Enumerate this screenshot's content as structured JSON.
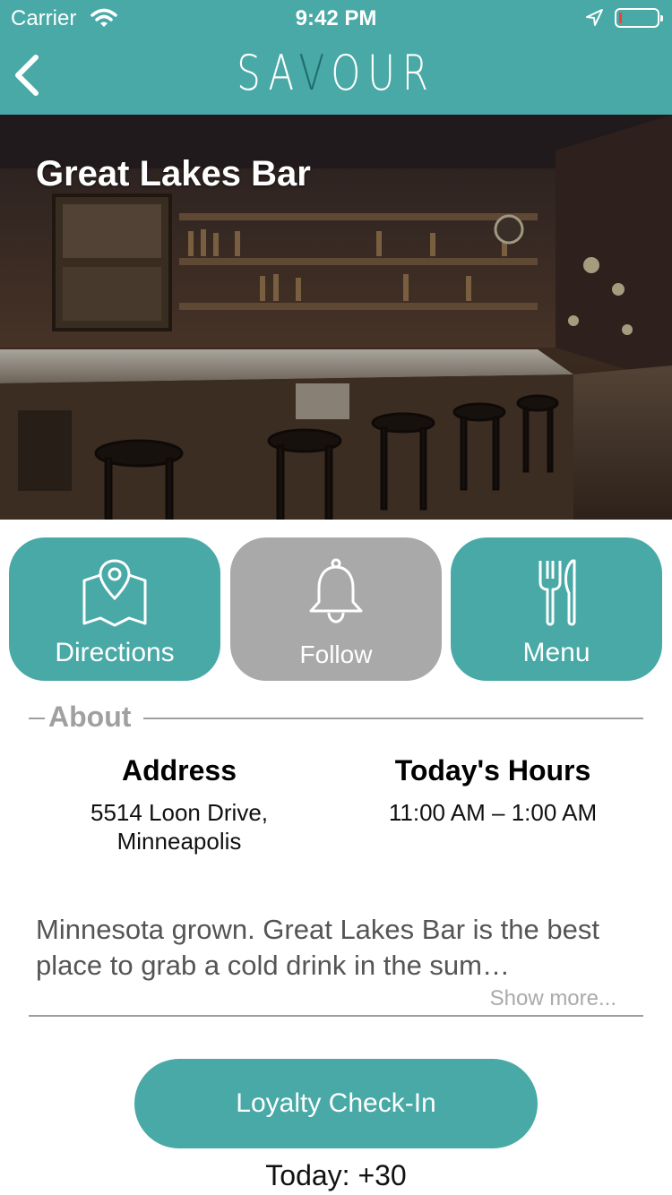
{
  "status_bar": {
    "carrier": "Carrier",
    "time": "9:42 PM",
    "battery_level": 0.05,
    "battery_color": "#ff3b30"
  },
  "nav": {
    "back_icon": "chevron-left-icon",
    "logo_parts": [
      "SA",
      "V",
      "OUR"
    ],
    "bar_color": "#48a9a6",
    "logo_accent": "#1f6e6b"
  },
  "hero": {
    "title": "Great Lakes Bar",
    "image": "bar-interior-photo"
  },
  "actions": [
    {
      "label": "Directions",
      "icon": "map-pin-icon",
      "color": "#48a9a6"
    },
    {
      "label": "Follow",
      "icon": "bell-icon",
      "color": "#a9a9a9"
    },
    {
      "label": "Menu",
      "icon": "fork-knife-icon",
      "color": "#48a9a6"
    }
  ],
  "about": {
    "heading": "About",
    "address_title": "Address",
    "address_line1": "5514 Loon Drive,",
    "address_line2": "Minneapolis",
    "hours_title": "Today's Hours",
    "hours_value": "11:00 AM – 1:00 AM",
    "description": "Minnesota grown. Great Lakes Bar is the best place to grab a cold drink in the sum…",
    "show_more": "Show more..."
  },
  "loyalty": {
    "button_label": "Loyalty Check-In",
    "today_text": "Today: +30"
  }
}
